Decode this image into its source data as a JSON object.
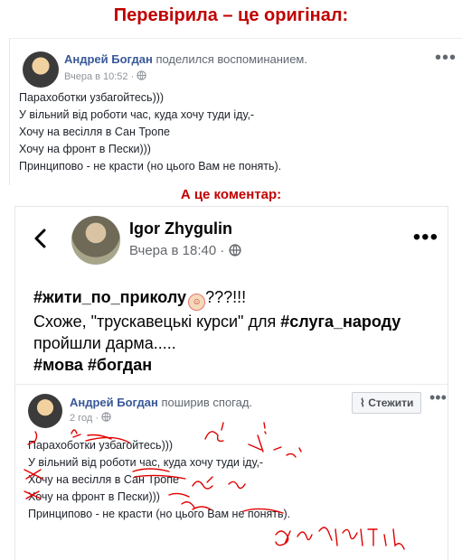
{
  "heading_top": "Перевірила – це оригінал:",
  "heading_mid": "А це коментар:",
  "original_post": {
    "author": "Андрей Богдан",
    "action": "поделился воспоминанием.",
    "time": "Вчера в 10:52 ·",
    "lines": [
      "Парахоботки узбагойтесь)))",
      "У вільний від роботи час, куда хочу туди іду,-",
      "Хочу на весілля в Сан Тропе",
      "Хочу на фронт в Пески)))",
      "Принципово - не красти (но цього Вам не понять)."
    ]
  },
  "comment_post": {
    "author": "Igor Zhygulin",
    "time": "Вчера в 18:40 ·",
    "tag_line": "#жити_по_приколу",
    "tag_line_suffix": "???!!!",
    "text_1": "Схоже, \"трускавецькі курси\" для",
    "tag_sluha": "#слуга_народу",
    "text_2": "пройшли дарма.....",
    "tags_bottom": "#мова #богдан",
    "shared": {
      "author": "Андрей Богдан",
      "action": "поширив спогад.",
      "time": "2 год ·",
      "follow_label": "Стежити",
      "lines": [
        "Парахоботки узбагойтесь)))",
        "У вільний від роботи час, куда хочу туди іду,-",
        "Хочу на весілля в Сан Тропе",
        "Хочу на фронт в Пески)))",
        "Принципово - не красти (но цього Вам не понять)."
      ],
      "handwritten_note": "зрозуміти"
    }
  },
  "colors": {
    "heading": "#c00000",
    "author_link": "#385898",
    "annotation": "#e00000"
  },
  "icons": [
    "globe-icon",
    "back-arrow-icon",
    "more-dots-icon",
    "rss-follow-icon",
    "clown-emoji-icon"
  ]
}
